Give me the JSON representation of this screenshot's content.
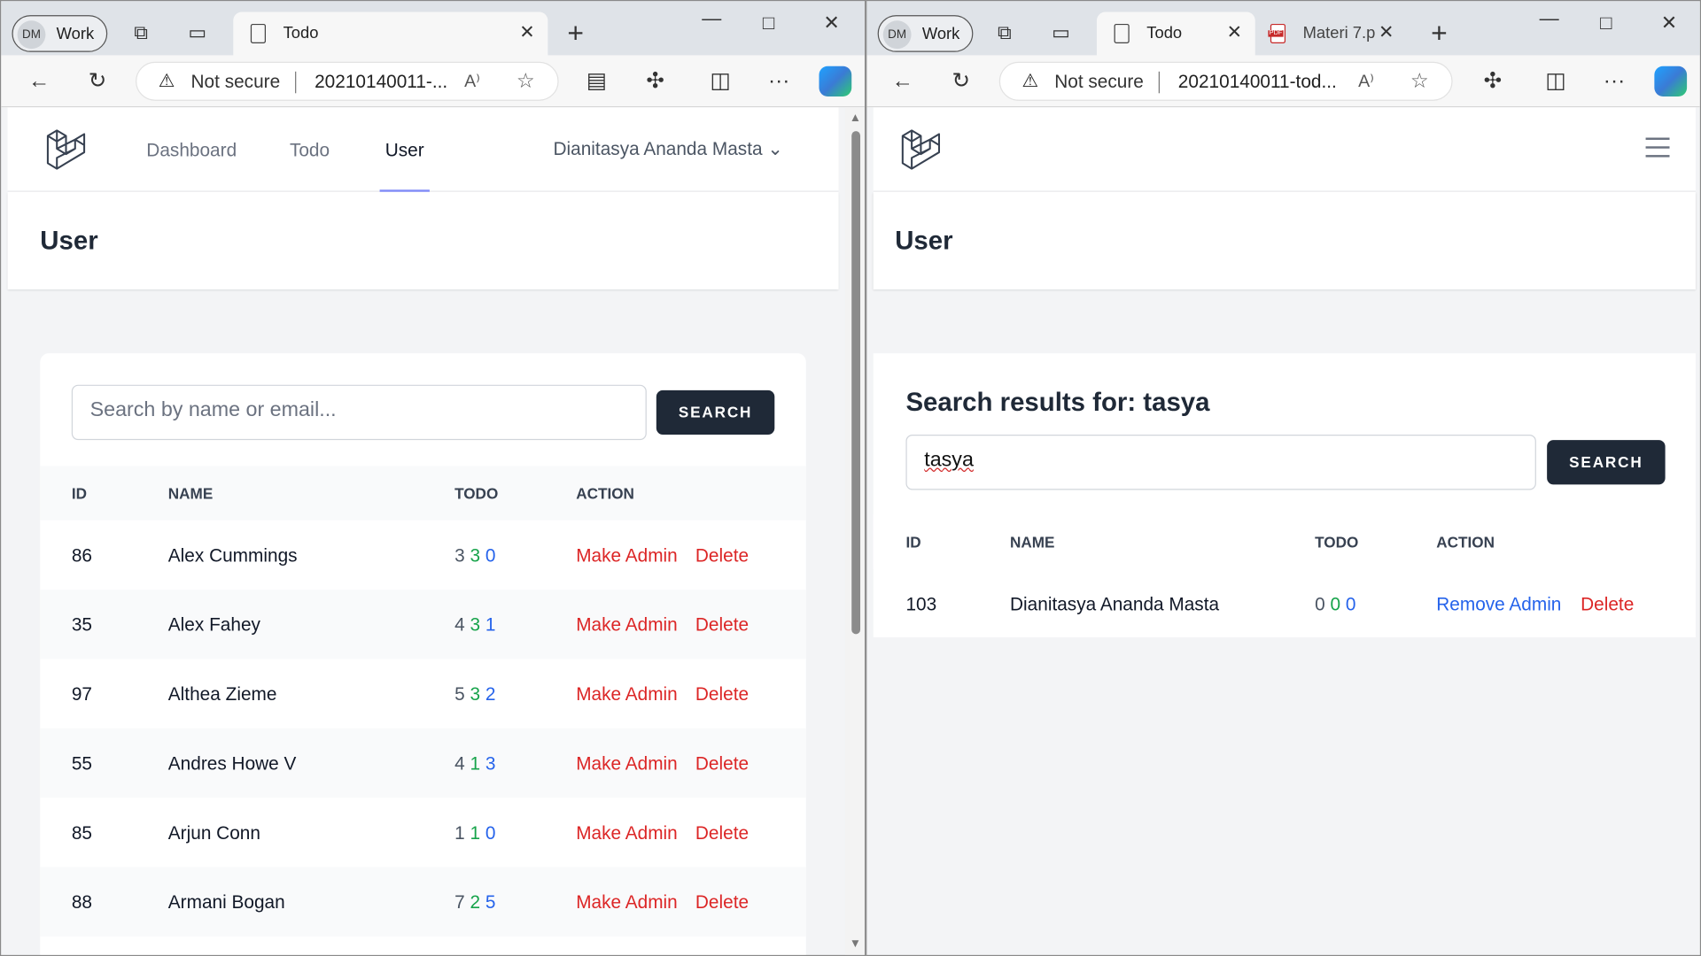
{
  "profile": {
    "initials": "DM",
    "name": "Work"
  },
  "left": {
    "tab": {
      "title": "Todo"
    },
    "address": {
      "security": "Not secure",
      "url": "20210140011-..."
    },
    "nav": {
      "dashboard": "Dashboard",
      "todo": "Todo",
      "user": "User",
      "username": "Dianitasya Ananda Masta"
    },
    "page_title": "User",
    "search": {
      "placeholder": "Search by name or email...",
      "button": "SEARCH"
    },
    "table": {
      "headers": {
        "id": "ID",
        "name": "NAME",
        "todo": "TODO",
        "action": "ACTION"
      },
      "rows": [
        {
          "id": "86",
          "name": "Alex Cummings",
          "t1": "3",
          "t2": "3",
          "t3": "0",
          "admin": "Make Admin",
          "delete": "Delete"
        },
        {
          "id": "35",
          "name": "Alex Fahey",
          "t1": "4",
          "t2": "3",
          "t3": "1",
          "admin": "Make Admin",
          "delete": "Delete"
        },
        {
          "id": "97",
          "name": "Althea Zieme",
          "t1": "5",
          "t2": "3",
          "t3": "2",
          "admin": "Make Admin",
          "delete": "Delete"
        },
        {
          "id": "55",
          "name": "Andres Howe V",
          "t1": "4",
          "t2": "1",
          "t3": "3",
          "admin": "Make Admin",
          "delete": "Delete"
        },
        {
          "id": "85",
          "name": "Arjun Conn",
          "t1": "1",
          "t2": "1",
          "t3": "0",
          "admin": "Make Admin",
          "delete": "Delete"
        },
        {
          "id": "88",
          "name": "Armani Bogan",
          "t1": "7",
          "t2": "2",
          "t3": "5",
          "admin": "Make Admin",
          "delete": "Delete"
        }
      ]
    }
  },
  "right": {
    "tabs": [
      {
        "title": "Todo"
      },
      {
        "title": "Materi 7.p"
      }
    ],
    "address": {
      "security": "Not secure",
      "url": "20210140011-tod..."
    },
    "page_title": "User",
    "results_title": "Search results for: tasya",
    "search": {
      "value": "tasya",
      "button": "SEARCH"
    },
    "table": {
      "headers": {
        "id": "ID",
        "name": "NAME",
        "todo": "TODO",
        "action": "ACTION"
      },
      "rows": [
        {
          "id": "103",
          "name": "Dianitasya Ananda Masta",
          "t1": "0",
          "t2": "0",
          "t3": "0",
          "admin": "Remove Admin",
          "delete": "Delete"
        }
      ]
    }
  },
  "icons": {
    "back": "←",
    "refresh": "↻",
    "star": "☆",
    "more": "···",
    "close": "✕",
    "plus": "+"
  }
}
